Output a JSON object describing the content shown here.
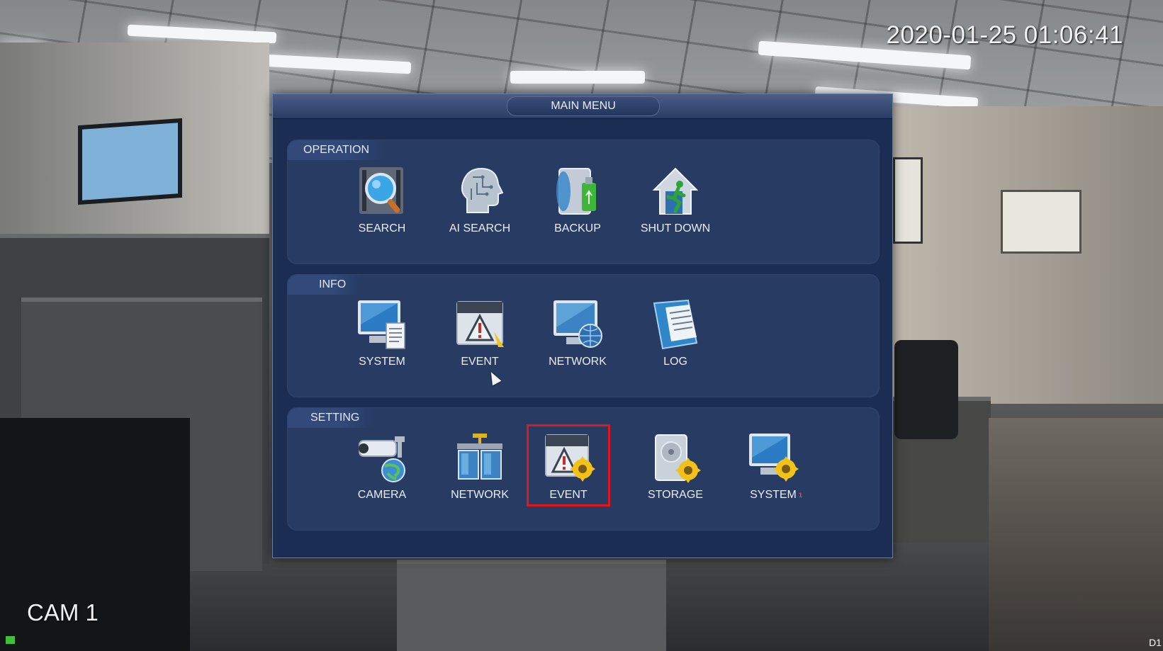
{
  "overlay": {
    "timestamp": "2020-01-25 01:06:41",
    "camera_label": "CAM 1",
    "corner_label": "D1"
  },
  "menu": {
    "title": "MAIN MENU",
    "sections": [
      {
        "label": "OPERATION",
        "items": [
          {
            "label": "SEARCH",
            "icon": "search-icon"
          },
          {
            "label": "AI SEARCH",
            "icon": "ai-search-icon"
          },
          {
            "label": "BACKUP",
            "icon": "backup-icon"
          },
          {
            "label": "SHUT DOWN",
            "icon": "shutdown-icon"
          }
        ]
      },
      {
        "label": "INFO",
        "items": [
          {
            "label": "SYSTEM",
            "icon": "system-info-icon"
          },
          {
            "label": "EVENT",
            "icon": "event-info-icon"
          },
          {
            "label": "NETWORK",
            "icon": "network-info-icon"
          },
          {
            "label": "LOG",
            "icon": "log-icon"
          }
        ]
      },
      {
        "label": "SETTING",
        "items": [
          {
            "label": "CAMERA",
            "icon": "camera-setting-icon"
          },
          {
            "label": "NETWORK",
            "icon": "network-setting-icon"
          },
          {
            "label": "EVENT",
            "icon": "event-setting-icon",
            "highlighted": true
          },
          {
            "label": "STORAGE",
            "icon": "storage-setting-icon"
          },
          {
            "label": "SYSTEM",
            "icon": "system-setting-icon",
            "badge": "1"
          }
        ]
      }
    ]
  },
  "colors": {
    "menu_bg": "#1b2d52",
    "section_bg": "#273b63",
    "highlight": "#e2161b",
    "gear": "#f2c21a"
  }
}
